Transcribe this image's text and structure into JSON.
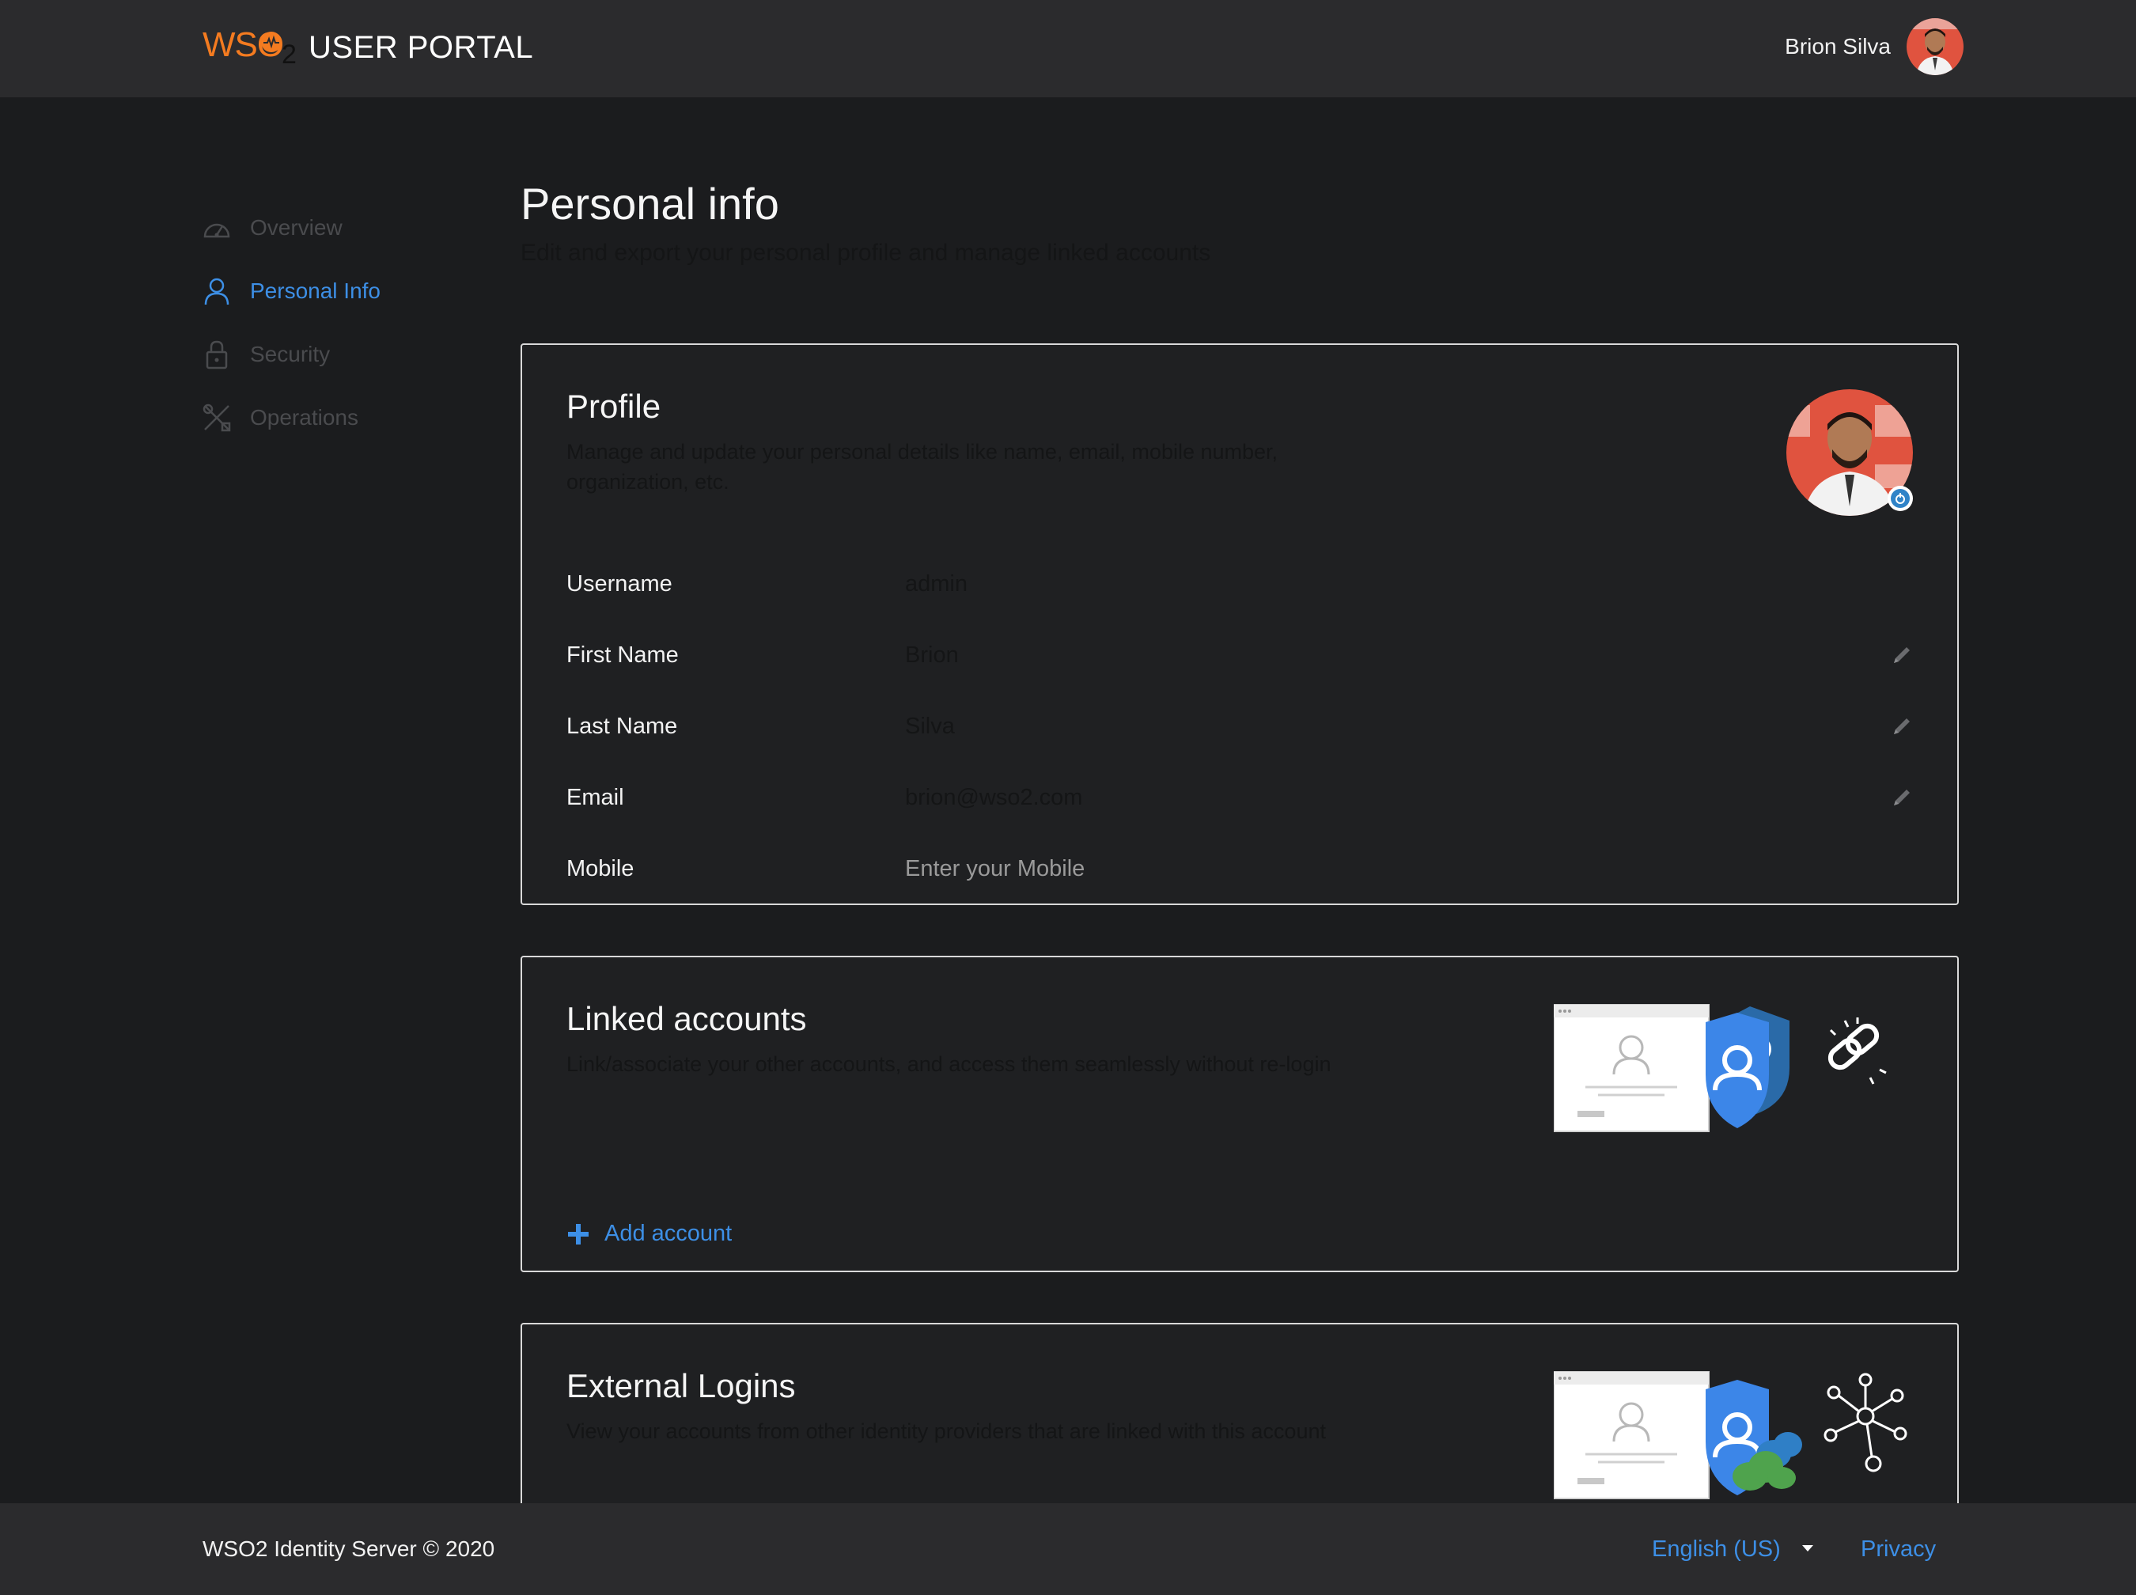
{
  "header": {
    "logo_text": "WSO",
    "logo_sub": "2",
    "portal_title": "USER PORTAL",
    "user_name": "Brion Silva"
  },
  "sidebar": {
    "items": [
      {
        "label": "Overview",
        "icon": "dashboard-icon",
        "active": false
      },
      {
        "label": "Personal Info",
        "icon": "user-icon",
        "active": true
      },
      {
        "label": "Security",
        "icon": "lock-icon",
        "active": false
      },
      {
        "label": "Operations",
        "icon": "tools-icon",
        "active": false
      }
    ]
  },
  "page": {
    "title": "Personal info",
    "subtitle": "Edit and export your personal profile and manage linked accounts"
  },
  "profile": {
    "title": "Profile",
    "description": "Manage and update your personal details like name, email, mobile number, organization, etc.",
    "fields": [
      {
        "label": "Username",
        "value": "admin",
        "editable": false
      },
      {
        "label": "First Name",
        "value": "Brion",
        "editable": true
      },
      {
        "label": "Last Name",
        "value": "Silva",
        "editable": true
      },
      {
        "label": "Email",
        "value": "brion@wso2.com",
        "editable": true
      },
      {
        "label": "Mobile",
        "placeholder": "Enter your Mobile",
        "editable": false
      }
    ]
  },
  "linked_accounts": {
    "title": "Linked accounts",
    "description": "Link/associate your other accounts, and access them seamlessly without re-login",
    "add_label": "Add account"
  },
  "external_logins": {
    "title": "External Logins",
    "description": "View your accounts from other identity providers that are linked with this account"
  },
  "footer": {
    "copyright": "WSO2 Identity Server © 2020",
    "language": "English (US)",
    "privacy": "Privacy"
  },
  "colors": {
    "accent": "#3d8fe6",
    "brand_orange": "#f47b20",
    "header_bg": "#2b2b2d",
    "page_bg": "#1b1c1e"
  }
}
